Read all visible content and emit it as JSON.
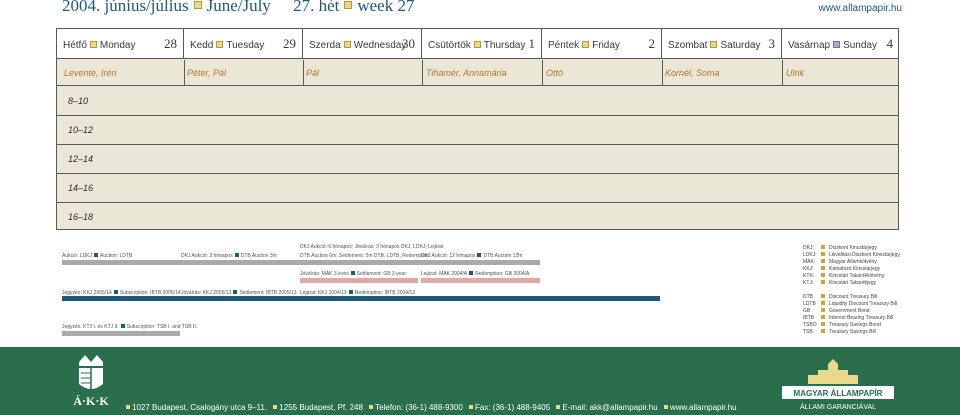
{
  "header": {
    "title_date": "2004. június/július",
    "title_month_en": "June/July",
    "title_week_hu": "27. hét",
    "title_week_en": "week 27",
    "url": "www.allampapir.hu"
  },
  "days": [
    {
      "hu": "Hétfő",
      "en": "Monday",
      "num": "28",
      "names": "Levente, Irén"
    },
    {
      "hu": "Kedd",
      "en": "Tuesday",
      "num": "29",
      "names": "Péter, Pál"
    },
    {
      "hu": "Szerda",
      "en": "Wednesday",
      "num": "30",
      "names": "Pál"
    },
    {
      "hu": "Csütörtök",
      "en": "Thursday",
      "num": "1",
      "names": "Tihamér, Annamária"
    },
    {
      "hu": "Péntek",
      "en": "Friday",
      "num": "2",
      "names": "Ottó"
    },
    {
      "hu": "Szombat",
      "en": "Saturday",
      "num": "3",
      "names": "Kornél, Soma"
    },
    {
      "hu": "Vasárnap",
      "en": "Sunday",
      "num": "4",
      "names": "Ulrik"
    }
  ],
  "time_slots": [
    "8–10",
    "10–12",
    "12–14",
    "14–16",
    "16–18"
  ],
  "auctions": {
    "mon_auction": "Aukció: LDKJ",
    "mon_auction_en": "Auction: LDTB",
    "tue_auction": "DKJ Aukció: 3 hónapos",
    "tue_auction_en": "DTB Auction 3m",
    "wed_auction": "DKJ Aukció: 6 hónapos; Jóváírás: 3 hónapos DKJ, LDKJ; Lejárat",
    "wed_auction_en": "DTB Auction 6m; Settlement: 3m DTB, LDTB; Redemption",
    "thu_auction": "DKJ Aukció: 12 hónapos",
    "thu_auction_en": "DTB Auction 12m",
    "wed_settle": "Jóváírás: MÁK 3 éves",
    "wed_settle_en": "Settlement: GB 3-year",
    "thu_redeem": "Lejárat: MÁK 2004/A",
    "thu_redeem_en": "Redemption: GB 2004/A",
    "mon_sub": "Jegyzés: KKJ 2005/14",
    "mon_sub_en": "Subscription: IBTB 2005/14",
    "tue_settle": "Jóváírás: KKJ 2005/13",
    "tue_settle_en": "Settlement: IBTB 2005/13",
    "wed_redeem": "Lejárat: KKJ 2004/13",
    "wed_redeem_en": "Redemption: IBTB 2004/13",
    "mon_sub2": "Jegyzés: KTJ I. és KTJ II.",
    "mon_sub2_en": "Subscription: TSB I. and TSB II."
  },
  "legend": [
    {
      "k": "DKJ:",
      "v": "Diszkont Kincstárjegy"
    },
    {
      "k": "LDKJ:",
      "v": "Likviditási Diszkont Kincstárjegy"
    },
    {
      "k": "MÁK:",
      "v": "Magyar Államkötvény"
    },
    {
      "k": "KKJ:",
      "v": "Kamatozó Kincstárjegy"
    },
    {
      "k": "KTK:",
      "v": "Kincstári Takarékkötvény"
    },
    {
      "k": "KTJ:",
      "v": "Kincstári Takarékjegy"
    },
    {
      "k": "DTB",
      "v": "Discount Treasury Bill"
    },
    {
      "k": "LDTB",
      "v": "Liquidity Discount Treasury Bill"
    },
    {
      "k": "GB",
      "v": "Government Bond"
    },
    {
      "k": "IBTB",
      "v": "Interest Bearing Treasury Bill"
    },
    {
      "k": "TSBO",
      "v": "Treasury Savings Bond"
    },
    {
      "k": "TSB",
      "v": "Treasury Savings Bill"
    }
  ],
  "footer": {
    "logo_left": "Á·K·K",
    "logo_right_name": "MAGYAR ÁLLAMPAPÍR",
    "logo_right_sub": "ÁLLAMI GARANCIÁVAL",
    "addr1": "1027 Budapest, Csalogány utca 9–11.",
    "addr2": "1255 Budapest, Pf. 248",
    "phone": "Telefon: (36-1) 488-9300",
    "fax": "Fax: (36-1) 488-9405",
    "email": "E-mail: akk@allampapir.hu",
    "web": "www.allampapir.hu"
  },
  "colors": {
    "accent_blue": "#1f5a78",
    "footer_green": "#2a6e4e",
    "names_orange": "#b2762f",
    "grid_beige": "#ebe7d7"
  }
}
